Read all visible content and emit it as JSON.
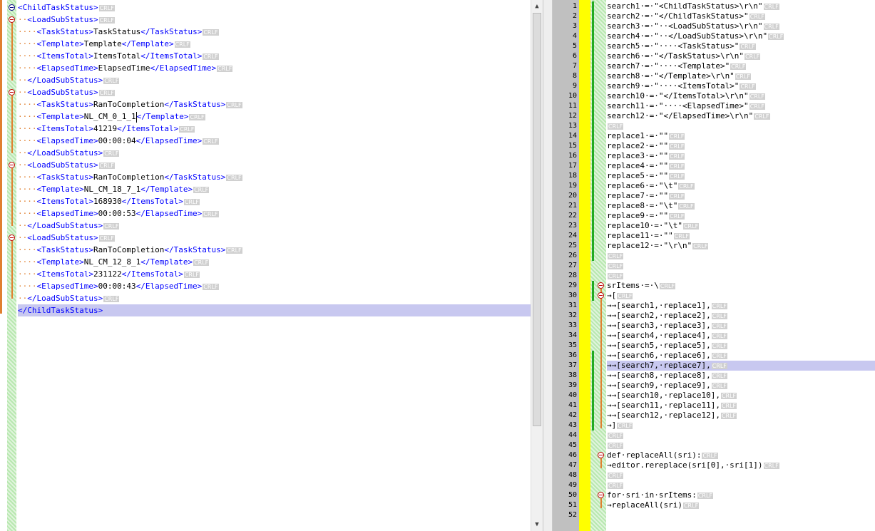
{
  "left_editor": {
    "lines": [
      {
        "indent": "",
        "open": "<ChildTaskStatus>",
        "text": "",
        "close": "",
        "eol": "CRLF"
      },
      {
        "indent": "··",
        "open": "<LoadSubStatus>",
        "text": "",
        "close": "",
        "eol": "CRLF"
      },
      {
        "indent": "····",
        "open": "<TaskStatus>",
        "text": "TaskStatus",
        "close": "</TaskStatus>",
        "eol": "CRLF"
      },
      {
        "indent": "····",
        "open": "<Template>",
        "text": "Template",
        "close": "</Template>",
        "eol": "CRLF"
      },
      {
        "indent": "····",
        "open": "<ItemsTotal>",
        "text": "ItemsTotal",
        "close": "</ItemsTotal>",
        "eol": "CRLF"
      },
      {
        "indent": "····",
        "open": "<ElapsedTime>",
        "text": "ElapsedTime",
        "close": "</ElapsedTime>",
        "eol": "CRLF"
      },
      {
        "indent": "··",
        "open": "</LoadSubStatus>",
        "text": "",
        "close": "",
        "eol": "CRLF"
      },
      {
        "indent": "··",
        "open": "<LoadSubStatus>",
        "text": "",
        "close": "",
        "eol": "CRLF"
      },
      {
        "indent": "····",
        "open": "<TaskStatus>",
        "text": "RanToCompletion",
        "close": "</TaskStatus>",
        "eol": "CRLF"
      },
      {
        "indent": "····",
        "open": "<Template>",
        "text": "NL_CM_0_1_1",
        "close": "</Template>",
        "eol": "CRLF"
      },
      {
        "indent": "····",
        "open": "<ItemsTotal>",
        "text": "41219",
        "close": "</ItemsTotal>",
        "eol": "CRLF"
      },
      {
        "indent": "····",
        "open": "<ElapsedTime>",
        "text": "00:00:04",
        "close": "</ElapsedTime>",
        "eol": "CRLF"
      },
      {
        "indent": "··",
        "open": "</LoadSubStatus>",
        "text": "",
        "close": "",
        "eol": "CRLF"
      },
      {
        "indent": "··",
        "open": "<LoadSubStatus>",
        "text": "",
        "close": "",
        "eol": "CRLF"
      },
      {
        "indent": "····",
        "open": "<TaskStatus>",
        "text": "RanToCompletion",
        "close": "</TaskStatus>",
        "eol": "CRLF"
      },
      {
        "indent": "····",
        "open": "<Template>",
        "text": "NL_CM_18_7_1",
        "close": "</Template>",
        "eol": "CRLF"
      },
      {
        "indent": "····",
        "open": "<ItemsTotal>",
        "text": "168930",
        "close": "</ItemsTotal>",
        "eol": "CRLF"
      },
      {
        "indent": "····",
        "open": "<ElapsedTime>",
        "text": "00:00:53",
        "close": "</ElapsedTime>",
        "eol": "CRLF"
      },
      {
        "indent": "··",
        "open": "</LoadSubStatus>",
        "text": "",
        "close": "",
        "eol": "CRLF"
      },
      {
        "indent": "··",
        "open": "<LoadSubStatus>",
        "text": "",
        "close": "",
        "eol": "CRLF"
      },
      {
        "indent": "····",
        "open": "<TaskStatus>",
        "text": "RanToCompletion",
        "close": "</TaskStatus>",
        "eol": "CRLF"
      },
      {
        "indent": "····",
        "open": "<Template>",
        "text": "NL_CM_12_8_1",
        "close": "</Template>",
        "eol": "CRLF"
      },
      {
        "indent": "····",
        "open": "<ItemsTotal>",
        "text": "231122",
        "close": "</ItemsTotal>",
        "eol": "CRLF"
      },
      {
        "indent": "····",
        "open": "<ElapsedTime>",
        "text": "00:00:43",
        "close": "</ElapsedTime>",
        "eol": "CRLF"
      },
      {
        "indent": "··",
        "open": "</LoadSubStatus>",
        "text": "",
        "close": "",
        "eol": "CRLF"
      },
      {
        "indent": "",
        "open": "</ChildTaskStatus>",
        "text": "",
        "close": "",
        "eol": ""
      }
    ]
  },
  "right_editor": {
    "lines": [
      {
        "n": "1",
        "code": "search1·=·\"<ChildTaskStatus>\\r\\n\"",
        "eol": "CRLF"
      },
      {
        "n": "2",
        "code": "search2·=·\"</ChildTaskStatus>\"",
        "eol": "CRLF"
      },
      {
        "n": "3",
        "code": "search3·=·\"··<LoadSubStatus>\\r\\n\"",
        "eol": "CRLF"
      },
      {
        "n": "4",
        "code": "search4·=·\"··</LoadSubStatus>\\r\\n\"",
        "eol": "CRLF"
      },
      {
        "n": "5",
        "code": "search5·=·\"····<TaskStatus>\"",
        "eol": "CRLF"
      },
      {
        "n": "6",
        "code": "search6·=·\"</TaskStatus>\\r\\n\"",
        "eol": "CRLF"
      },
      {
        "n": "7",
        "code": "search7·=·\"····<Template>\"",
        "eol": "CRLF"
      },
      {
        "n": "8",
        "code": "search8·=·\"</Template>\\r\\n\"",
        "eol": "CRLF"
      },
      {
        "n": "9",
        "code": "search9·=·\"····<ItemsTotal>\"",
        "eol": "CRLF"
      },
      {
        "n": "10",
        "code": "search10·=·\"</ItemsTotal>\\r\\n\"",
        "eol": "CRLF"
      },
      {
        "n": "11",
        "code": "search11·=·\"····<ElapsedTime>\"",
        "eol": "CRLF"
      },
      {
        "n": "12",
        "code": "search12·=·\"</ElapsedTime>\\r\\n\"",
        "eol": "CRLF"
      },
      {
        "n": "13",
        "code": "",
        "eol": "CRLF"
      },
      {
        "n": "14",
        "code": "replace1·=·\"\"",
        "eol": "CRLF"
      },
      {
        "n": "15",
        "code": "replace2·=·\"\"",
        "eol": "CRLF"
      },
      {
        "n": "16",
        "code": "replace3·=·\"\"",
        "eol": "CRLF"
      },
      {
        "n": "17",
        "code": "replace4·=·\"\"",
        "eol": "CRLF"
      },
      {
        "n": "18",
        "code": "replace5·=·\"\"",
        "eol": "CRLF"
      },
      {
        "n": "19",
        "code": "replace6·=·\"\\t\"",
        "eol": "CRLF"
      },
      {
        "n": "20",
        "code": "replace7·=·\"\"",
        "eol": "CRLF"
      },
      {
        "n": "21",
        "code": "replace8·=·\"\\t\"",
        "eol": "CRLF"
      },
      {
        "n": "22",
        "code": "replace9·=·\"\"",
        "eol": "CRLF"
      },
      {
        "n": "23",
        "code": "replace10·=·\"\\t\"",
        "eol": "CRLF"
      },
      {
        "n": "24",
        "code": "replace11·=·\"\"",
        "eol": "CRLF"
      },
      {
        "n": "25",
        "code": "replace12·=·\"\\r\\n\"",
        "eol": "CRLF"
      },
      {
        "n": "26",
        "code": "",
        "eol": "CRLF"
      },
      {
        "n": "27",
        "code": "",
        "eol": "CRLF"
      },
      {
        "n": "28",
        "code": "",
        "eol": "CRLF"
      },
      {
        "n": "29",
        "code": "srItems·=·\\",
        "eol": "CRLF"
      },
      {
        "n": "30",
        "code": "→[",
        "eol": "CRLF"
      },
      {
        "n": "31",
        "code": "→→[search1,·replace1],",
        "eol": "CRLF"
      },
      {
        "n": "32",
        "code": "→→[search2,·replace2],",
        "eol": "CRLF"
      },
      {
        "n": "33",
        "code": "→→[search3,·replace3],",
        "eol": "CRLF"
      },
      {
        "n": "34",
        "code": "→→[search4,·replace4],",
        "eol": "CRLF"
      },
      {
        "n": "35",
        "code": "→→[search5,·replace5],",
        "eol": "CRLF"
      },
      {
        "n": "36",
        "code": "→→[search6,·replace6],",
        "eol": "CRLF"
      },
      {
        "n": "37",
        "code": "→→[search7,·replace7],",
        "eol": "CRLF"
      },
      {
        "n": "38",
        "code": "→→[search8,·replace8],",
        "eol": "CRLF"
      },
      {
        "n": "39",
        "code": "→→[search9,·replace9],",
        "eol": "CRLF"
      },
      {
        "n": "40",
        "code": "→→[search10,·replace10],",
        "eol": "CRLF"
      },
      {
        "n": "41",
        "code": "→→[search11,·replace11],",
        "eol": "CRLF"
      },
      {
        "n": "42",
        "code": "→→[search12,·replace12],",
        "eol": "CRLF"
      },
      {
        "n": "43",
        "code": "→]",
        "eol": "CRLF"
      },
      {
        "n": "44",
        "code": "",
        "eol": "CRLF"
      },
      {
        "n": "45",
        "code": "",
        "eol": "CRLF"
      },
      {
        "n": "46",
        "code": "def·replaceAll(sri):",
        "eol": "CRLF"
      },
      {
        "n": "47",
        "code": "→editor.rereplace(sri[0],·sri[1])",
        "eol": "CRLF"
      },
      {
        "n": "48",
        "code": "",
        "eol": "CRLF"
      },
      {
        "n": "49",
        "code": "",
        "eol": "CRLF"
      },
      {
        "n": "50",
        "code": "for·sri·in·srItems:",
        "eol": "CRLF"
      },
      {
        "n": "51",
        "code": "→replaceAll(sri)",
        "eol": "CRLF"
      },
      {
        "n": "52",
        "code": "",
        "eol": ""
      }
    ]
  },
  "colors": {
    "tag": "#0000ff",
    "indent_guide": "#e08030",
    "current_line": "#c8c8f0",
    "line_number_bg": "#c0c0c0",
    "change_margin": "#ffff00"
  }
}
